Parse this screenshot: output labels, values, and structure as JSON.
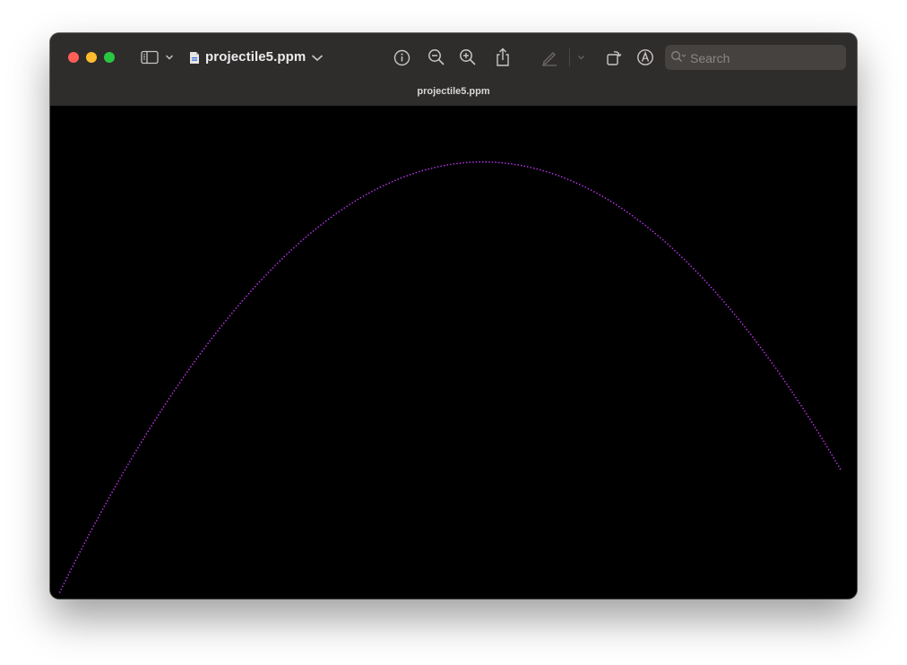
{
  "window": {
    "title": "projectile5.ppm",
    "tab_title": "projectile5.ppm"
  },
  "toolbar": {
    "icons": [
      "sidebar-icon",
      "chevron-down-icon",
      "document-icon",
      "info-icon",
      "zoom-out-icon",
      "zoom-in-icon",
      "share-icon",
      "markup-pen-icon",
      "rotate-icon",
      "annotate-icon"
    ],
    "search_placeholder": "Search"
  },
  "image": {
    "background": "#000000",
    "trajectory_color": "#c838ff"
  },
  "colors": {
    "titlebar": "#2f2c2c",
    "close": "#fe5f57",
    "minimize": "#febc2e",
    "maximize": "#28c840"
  }
}
